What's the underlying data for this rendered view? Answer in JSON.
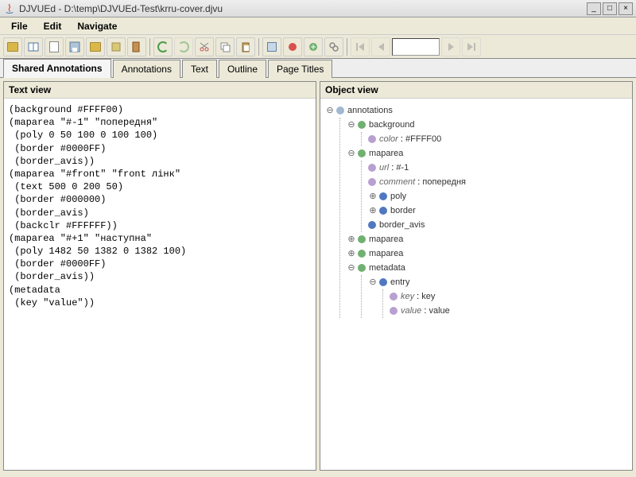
{
  "window": {
    "title": "DJVUEd - D:\\temp\\DJVUEd-Test\\krru-cover.djvu"
  },
  "menu": {
    "file": "File",
    "edit": "Edit",
    "navigate": "Navigate"
  },
  "tabs": {
    "shared_annotations": "Shared Annotations",
    "annotations": "Annotations",
    "text": "Text",
    "outline": "Outline",
    "page_titles": "Page Titles"
  },
  "panes": {
    "text_view": "Text view",
    "object_view": "Object view"
  },
  "text_lines": [
    "(background #FFFF00)",
    "(maparea \"#-1\" \"попередня\"",
    " (poly 0 50 100 0 100 100)",
    " (border #0000FF)",
    " (border_avis))",
    "(maparea \"#front\" \"front лінк\"",
    " (text 500 0 200 50)",
    " (border #000000)",
    " (border_avis)",
    " (backclr #FFFFFF))",
    "(maparea \"#+1\" \"наступна\"",
    " (poly 1482 50 1382 0 1382 100)",
    " (border #0000FF)",
    " (border_avis))",
    "(metadata",
    " (key \"value\"))"
  ],
  "tree": {
    "root": "annotations",
    "bg": {
      "label": "background",
      "color_key": "color",
      "color_val": "#FFFF00"
    },
    "map1": {
      "label": "maparea",
      "url_key": "url",
      "url_val": "#-1",
      "comment_key": "comment",
      "comment_val": "попередня"
    },
    "poly": "poly",
    "border": "border",
    "border_avis": "border_avis",
    "map2": "maparea",
    "map3": "maparea",
    "metadata": "metadata",
    "entry": "entry",
    "key_key": "key",
    "key_val": "key",
    "value_key": "value",
    "value_val": "value"
  }
}
